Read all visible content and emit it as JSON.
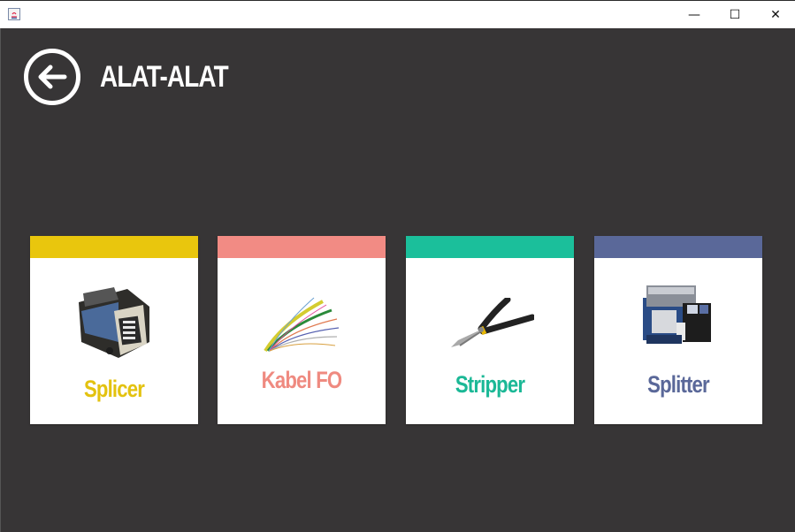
{
  "window": {
    "controls": {
      "minimize": "—",
      "maximize": "☐",
      "close": "✕"
    }
  },
  "header": {
    "title": "ALAT-ALAT",
    "back_icon": "arrow-left-circle-icon"
  },
  "cards": [
    {
      "label": "Splicer",
      "accent": "#e9c60d",
      "label_color": "#e3c20f",
      "image": "fusion-splicer"
    },
    {
      "label": "Kabel FO",
      "accent": "#f28b84",
      "label_color": "#ef8a80",
      "image": "fiber-optic-cable"
    },
    {
      "label": "Stripper",
      "accent": "#1bbf9b",
      "label_color": "#1bb896",
      "image": "pliers-stripper"
    },
    {
      "label": "Splitter",
      "accent": "#5a6899",
      "label_color": "#5a6899",
      "image": "fiber-cleaver"
    }
  ],
  "colors": {
    "background": "#373536",
    "titlebar": "#ffffff"
  }
}
